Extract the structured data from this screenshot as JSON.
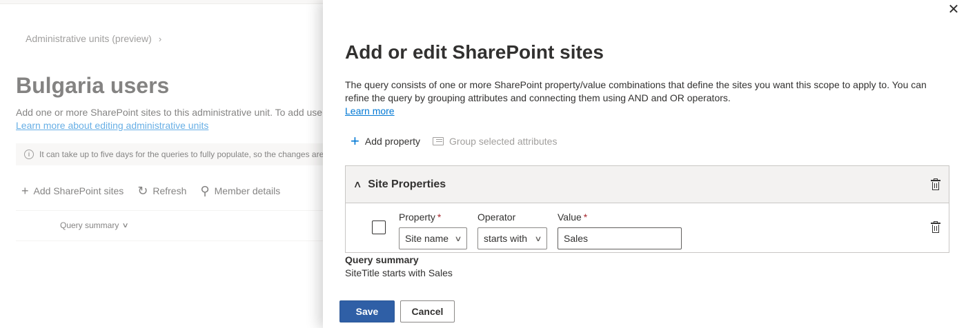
{
  "background": {
    "breadcrumb": {
      "item": "Administrative units (preview)",
      "separator": "›"
    },
    "title": "Bulgaria users",
    "description": "Add one or more SharePoint sites to this administrative unit. To add user",
    "learn_link": "Learn more about editing administrative units",
    "info_bar": "It can take up to five days for the queries to fully populate, so the changes are",
    "toolbar": {
      "add_label": "Add SharePoint sites",
      "refresh_label": "Refresh",
      "member_label": "Member details"
    },
    "column_header": "Query summary"
  },
  "panel": {
    "title": "Add or edit SharePoint sites",
    "description": "The query consists of one or more SharePoint property/value combinations that define the sites you want this scope to apply to. You can refine the query by grouping attributes and connecting them using AND and OR operators.",
    "learn_more": "Learn more",
    "commands": {
      "add_property": "Add property",
      "group_attributes": "Group selected attributes"
    },
    "group": {
      "title": "Site Properties",
      "row": {
        "property_label": "Property",
        "property_value": "Site name",
        "operator_label": "Operator",
        "operator_value": "starts with",
        "value_label": "Value",
        "value_value": "Sales",
        "required_mark": "*"
      }
    },
    "query_summary": {
      "label": "Query summary",
      "text": "SiteTitle starts with Sales"
    },
    "buttons": {
      "save": "Save",
      "cancel": "Cancel"
    },
    "close_glyph": "✕"
  }
}
